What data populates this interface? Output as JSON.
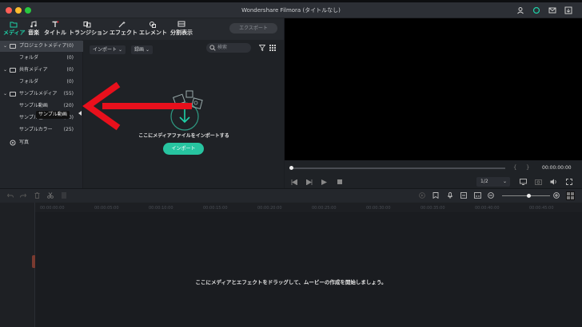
{
  "window": {
    "title": "Wondershare Filmora (タイトルなし)"
  },
  "toolbar": {
    "tabs": [
      {
        "label": "メディア",
        "icon": "folder-icon",
        "active": true
      },
      {
        "label": "音楽",
        "icon": "music-icon"
      },
      {
        "label": "タイトル",
        "icon": "title-icon"
      },
      {
        "label": "トランジション",
        "icon": "transition-icon"
      },
      {
        "label": "エフェクト",
        "icon": "effects-icon"
      },
      {
        "label": "エレメント",
        "icon": "elements-icon"
      },
      {
        "label": "分割表示",
        "icon": "split-screen-icon"
      }
    ],
    "export_label": "エクスポート"
  },
  "sidebar": {
    "items": [
      {
        "label": "プロジェクトメディア",
        "count": "(0)"
      },
      {
        "label": "フォルダ",
        "count": "(0)"
      },
      {
        "label": "共有メディア",
        "count": "(0)"
      },
      {
        "label": "フォルダ",
        "count": "(0)"
      },
      {
        "label": "サンプルメディア",
        "count": "(55)"
      },
      {
        "label": "サンプル動画",
        "count": "(20)"
      },
      {
        "label": "サンプル色",
        "count": "(10)"
      },
      {
        "label": "サンプルカラー",
        "count": "(25)"
      },
      {
        "label": "写真",
        "count": ""
      }
    ],
    "tooltip": "サンプル動画"
  },
  "media": {
    "import_dropdown": "インポート",
    "sort_dropdown": "録画",
    "search_placeholder": "検索",
    "empty_text": "ここにメディアファイルをインポートする",
    "import_button": "インポート"
  },
  "player": {
    "timecode": "00:00:00:00",
    "ratio": "1/2"
  },
  "timeline": {
    "drop_hint": "ここにメディアとエフェクトをドラッグして、ムービーの作成を開始しましょう。",
    "ruler_ticks": [
      "00:00:00:00",
      "00:00:05:00",
      "00:00:10:00",
      "00:00:15:00",
      "00:00:20:00",
      "00:00:25:00",
      "00:00:30:00",
      "00:00:35:00",
      "00:00:40:00",
      "00:00:45:00"
    ]
  },
  "colors": {
    "accent": "#1fd1a7",
    "arrow": "#e8101c"
  }
}
